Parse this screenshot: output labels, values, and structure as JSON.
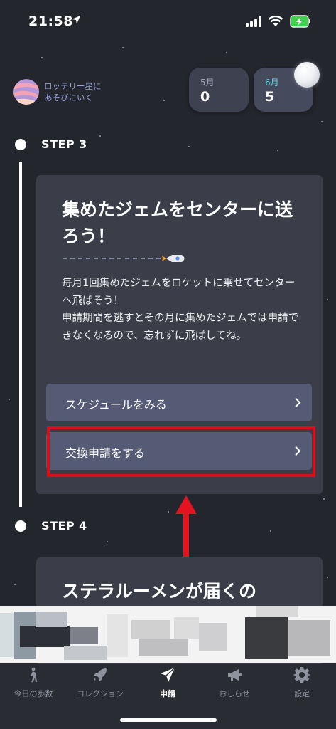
{
  "status_bar": {
    "time": "21:58"
  },
  "header": {
    "planet_label": "ロッテリー星に\nあそびにいく",
    "months": [
      {
        "label": "5月",
        "value": "0"
      },
      {
        "label": "6月",
        "value": "5"
      }
    ]
  },
  "step3": {
    "label": "STEP 3",
    "title": "集めたジェムをセンターに送ろう！",
    "body": "毎月1回集めたジェムをロケットに乗せてセンターへ飛ばそう！\n申請期間を逃すとその月に集めたジェムでは申請できなくなるので、忘れずに飛ばしてね。",
    "buttons": [
      {
        "label": "スケジュールをみる"
      },
      {
        "label": "交換申請をする"
      }
    ]
  },
  "step4": {
    "label": "STEP 4",
    "title": "ステラルーメンが届くの"
  },
  "tabs": [
    {
      "label": "今日の歩数",
      "icon": "walking-person-icon"
    },
    {
      "label": "コレクション",
      "icon": "rocket-icon"
    },
    {
      "label": "申請",
      "icon": "paper-plane-icon",
      "active": true
    },
    {
      "label": "おしらせ",
      "icon": "megaphone-icon"
    },
    {
      "label": "設定",
      "icon": "gear-icon"
    }
  ],
  "colors": {
    "background": "#24262e",
    "card": "#3b3e49",
    "button": "#565b75",
    "highlight": "#d80e1b",
    "accent_cyan": "#5cd6e6"
  }
}
